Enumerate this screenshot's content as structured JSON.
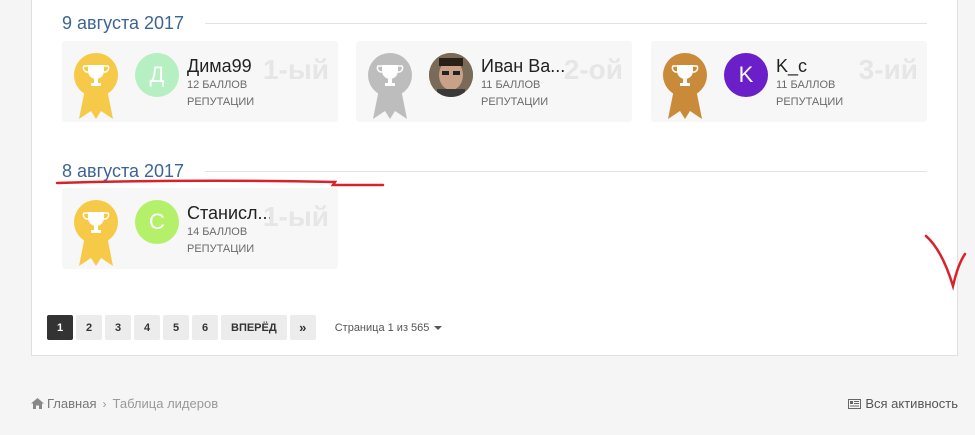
{
  "days": [
    {
      "date": "9 августа 2017",
      "entries": [
        {
          "rank": "1-ый",
          "name": "Дима99",
          "points": "12 БАЛЛОВ",
          "rep": "РЕПУТАЦИИ",
          "avatar_letter": "Д",
          "avatar_color": "#b6f0c2",
          "medal": "gold"
        },
        {
          "rank": "2-ой",
          "name": "Иван Ва...",
          "points": "11 БАЛЛОВ",
          "rep": "РЕПУТАЦИИ",
          "avatar_letter": "",
          "avatar_color": "#6b5a4a",
          "medal": "silver"
        },
        {
          "rank": "3-ий",
          "name": "K_c",
          "points": "11 БАЛЛОВ",
          "rep": "РЕПУТАЦИИ",
          "avatar_letter": "K",
          "avatar_color": "#6a1fc8",
          "medal": "bronze"
        }
      ]
    },
    {
      "date": "8 августа 2017",
      "entries": [
        {
          "rank": "1-ый",
          "name": "Станисл...",
          "points": "14 БАЛЛОВ",
          "rep": "РЕПУТАЦИИ",
          "avatar_letter": "С",
          "avatar_color": "#b4f06a",
          "medal": "gold"
        }
      ]
    }
  ],
  "pagination": {
    "pages": [
      "1",
      "2",
      "3",
      "4",
      "5",
      "6"
    ],
    "next_label": "ВПЕРЁД",
    "last_label": "»",
    "info": "Страница 1 из 565"
  },
  "breadcrumb": {
    "home": "Главная",
    "sep": "›",
    "current": "Таблица лидеров"
  },
  "activity_label": "Вся активность",
  "colors": {
    "gold": "#f7c948",
    "silver": "#bdbdbd",
    "bronze": "#c98a3a",
    "accent": "#3d6594",
    "annotation": "#d8232a"
  },
  "icons": {
    "award": "trophy-ribbon-icon",
    "home": "home-icon",
    "activity": "activity-feed-icon",
    "pager_caret": "caret-down-icon"
  }
}
